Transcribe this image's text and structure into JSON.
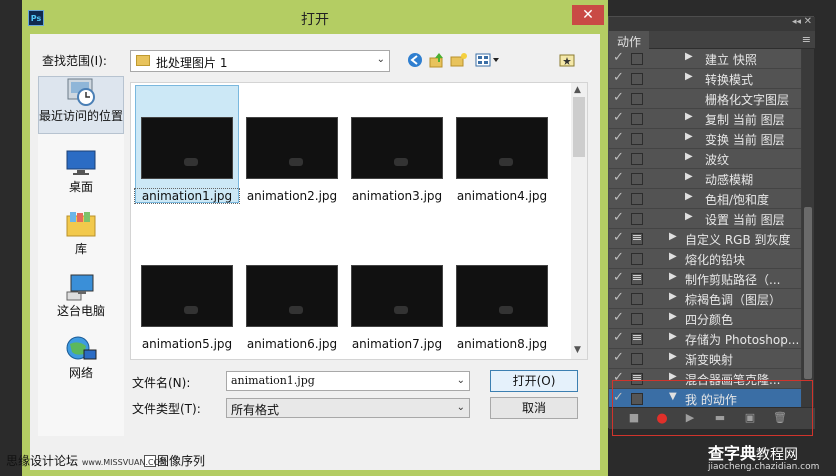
{
  "dialog": {
    "title": "打开",
    "app_badge": "Ps",
    "close_glyph": "✕",
    "look_in_label": "查找范围(I):",
    "look_in_value": "批处理图片 1",
    "places": [
      {
        "label": "最近访问的位置",
        "icon": "recent-places-icon"
      },
      {
        "label": "桌面",
        "icon": "desktop-icon"
      },
      {
        "label": "库",
        "icon": "libraries-icon"
      },
      {
        "label": "这台电脑",
        "icon": "computer-icon"
      },
      {
        "label": "网络",
        "icon": "network-icon"
      }
    ],
    "files": [
      {
        "name": "animation1.jpg",
        "selected": true
      },
      {
        "name": "animation2.jpg"
      },
      {
        "name": "animation3.jpg"
      },
      {
        "name": "animation4.jpg"
      },
      {
        "name": "animation5.jpg"
      },
      {
        "name": "animation6.jpg"
      },
      {
        "name": "animation7.jpg"
      },
      {
        "name": "animation8.jpg"
      }
    ],
    "filename_label": "文件名(N):",
    "filename_value": "animation1.jpg",
    "filetype_label": "文件类型(T):",
    "filetype_value": "所有格式",
    "open_button": "打开(O)",
    "cancel_button": "取消",
    "image_sequence_label": "图像序列"
  },
  "actions_panel": {
    "tab_label": "动作",
    "collapse_glyph": "◂◂",
    "close_glyph": "✕",
    "menu_glyph": "≡",
    "items": [
      {
        "label": "建立 快照",
        "level": 2,
        "check": true,
        "dialog": false
      },
      {
        "label": "转换模式",
        "level": 2,
        "check": true,
        "dialog": false
      },
      {
        "label": "栅格化文字图层",
        "level": 3,
        "check": true,
        "dialog": false
      },
      {
        "label": "复制 当前 图层",
        "level": 2,
        "check": true,
        "dialog": false
      },
      {
        "label": "变换 当前 图层",
        "level": 2,
        "check": true,
        "dialog": false
      },
      {
        "label": "波纹",
        "level": 2,
        "check": true,
        "dialog": false
      },
      {
        "label": "动感模糊",
        "level": 2,
        "check": true,
        "dialog": false
      },
      {
        "label": "色相/饱和度",
        "level": 2,
        "check": true,
        "dialog": false
      },
      {
        "label": "设置 当前 图层",
        "level": 2,
        "check": true,
        "dialog": false
      },
      {
        "label": "自定义 RGB 到灰度",
        "level": 1,
        "check": true,
        "dialog": true
      },
      {
        "label": "熔化的铅块",
        "level": 1,
        "check": true,
        "dialog": false
      },
      {
        "label": "制作剪贴路径（...",
        "level": 1,
        "check": true,
        "dialog": true
      },
      {
        "label": "棕褐色调（图层）",
        "level": 1,
        "check": true,
        "dialog": false
      },
      {
        "label": "四分颜色",
        "level": 1,
        "check": true,
        "dialog": false
      },
      {
        "label": "存储为 Photoshop...",
        "level": 1,
        "check": true,
        "dialog": true
      },
      {
        "label": "渐变映射",
        "level": 1,
        "check": true,
        "dialog": false
      },
      {
        "label": "混合器画笔克隆...",
        "level": 1,
        "check": true,
        "dialog": true
      },
      {
        "label": "我 的动作",
        "level": 0,
        "check": true,
        "dialog": false,
        "expanded": true,
        "selected": true
      }
    ],
    "toolbar": [
      {
        "name": "stop-button",
        "glyph": "■"
      },
      {
        "name": "record-button",
        "glyph": "●"
      },
      {
        "name": "play-button",
        "glyph": "▶"
      },
      {
        "name": "new-set-button",
        "glyph": "▬"
      },
      {
        "name": "new-action-button",
        "glyph": "▣"
      },
      {
        "name": "delete-button",
        "glyph": "🗑"
      }
    ]
  },
  "watermark": {
    "left_text": "思缘设计论坛",
    "left_url": "www.MISSVUAN.COM",
    "right_title": "查字典",
    "right_title2": "教程网",
    "right_url": "jiaocheng.chazidian.com"
  },
  "colors": {
    "dialog_frame": "#b4cd63",
    "close_red": "#c94a45",
    "ps_panel_bg": "#535353",
    "ps_selected": "#3a6ea5",
    "record_red": "#e0302a",
    "highlight_box": "#d0342c"
  }
}
